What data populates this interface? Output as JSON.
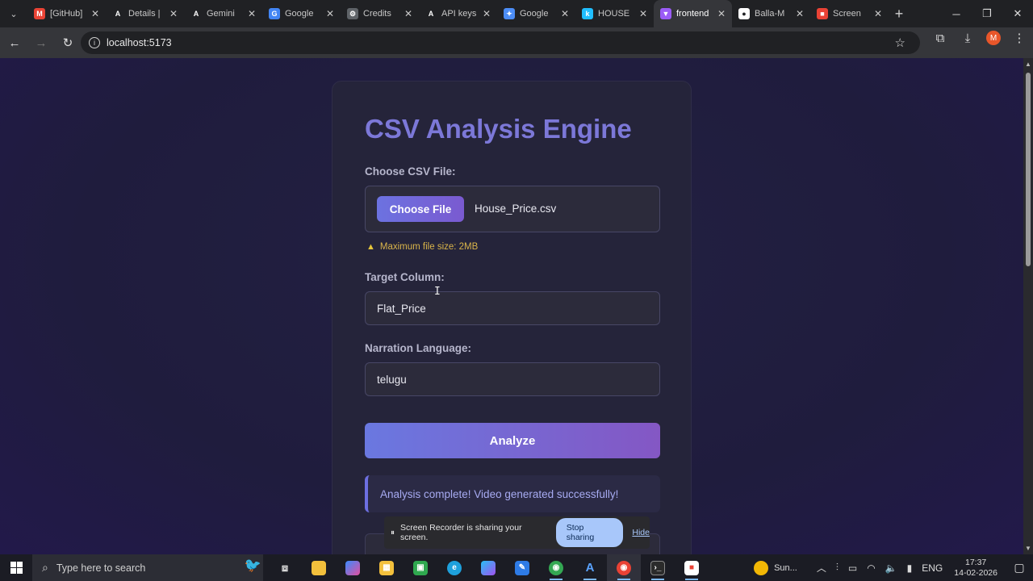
{
  "browser": {
    "tabs": [
      {
        "title": "[GitHub]",
        "icon": "gmail-icon",
        "color": "#ea4335",
        "glyph": "M"
      },
      {
        "title": "Details |",
        "icon": "details-icon",
        "color": "#202124",
        "glyph": "A"
      },
      {
        "title": "Gemini",
        "icon": "gemini-icon",
        "color": "#202124",
        "glyph": "A"
      },
      {
        "title": "Google",
        "icon": "google-cloud-icon",
        "color": "#4285f4",
        "glyph": "G"
      },
      {
        "title": "Credits",
        "icon": "gear-icon",
        "color": "#5f6368",
        "glyph": "⚙"
      },
      {
        "title": "API keys",
        "icon": "api-icon",
        "color": "#202124",
        "glyph": "A"
      },
      {
        "title": "Google",
        "icon": "gemini-star-icon",
        "color": "#4c8df6",
        "glyph": "✦"
      },
      {
        "title": "HOUSE",
        "icon": "kaggle-icon",
        "color": "#20beff",
        "glyph": "k"
      },
      {
        "title": "frontend",
        "icon": "vite-icon",
        "color": "#9b5cf6",
        "glyph": "▼",
        "active": true
      },
      {
        "title": "Balla-M",
        "icon": "github-icon",
        "color": "#ffffff",
        "glyph": "●"
      },
      {
        "title": "Screen",
        "icon": "screen-recorder-icon",
        "color": "#e94235",
        "glyph": "■"
      }
    ],
    "url": "localhost:5173"
  },
  "page": {
    "title": "CSV Analysis Engine",
    "file_label": "Choose CSV File:",
    "choose_button": "Choose File",
    "file_name": "House_Price.csv",
    "warning": "Maximum file size: 2MB",
    "target_label": "Target Column:",
    "target_value": "Flat_Price",
    "language_label": "Narration Language:",
    "language_value": "telugu",
    "analyze_button": "Analyze",
    "success_message": "Analysis complete! Video generated successfully!"
  },
  "recorder": {
    "message": "Screen Recorder is sharing your screen.",
    "stop_label": "Stop sharing",
    "hide_label": "Hide"
  },
  "taskbar": {
    "search_placeholder": "Type here to search",
    "weather": "Sun...",
    "language": "ENG",
    "time": "17:37",
    "date": "14-02-2026"
  }
}
